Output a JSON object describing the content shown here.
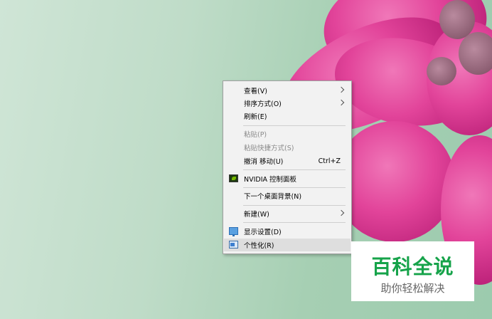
{
  "desktop": {
    "wallpaper": "pink succulent flower on green background",
    "colors": {
      "background": "#bfdcc8",
      "petal": "#e2449a"
    }
  },
  "context_menu": {
    "items": [
      {
        "label": "查看(V)",
        "has_submenu": true,
        "disabled": false
      },
      {
        "label": "排序方式(O)",
        "has_submenu": true,
        "disabled": false
      },
      {
        "label": "刷新(E)",
        "has_submenu": false,
        "disabled": false
      },
      {
        "label": "粘贴(P)",
        "has_submenu": false,
        "disabled": true
      },
      {
        "label": "粘贴快捷方式(S)",
        "has_submenu": false,
        "disabled": true
      },
      {
        "label": "撤消 移动(U)",
        "shortcut": "Ctrl+Z",
        "has_submenu": false,
        "disabled": false
      },
      {
        "label": "NVIDIA 控制面板",
        "icon": "nvidia-icon",
        "has_submenu": false,
        "disabled": false
      },
      {
        "label": "下一个桌面背景(N)",
        "has_submenu": false,
        "disabled": false
      },
      {
        "label": "新建(W)",
        "has_submenu": true,
        "disabled": false
      },
      {
        "label": "显示设置(D)",
        "icon": "display-settings-icon",
        "has_submenu": false,
        "disabled": false
      },
      {
        "label": "个性化(R)",
        "icon": "personalize-icon",
        "has_submenu": false,
        "disabled": false,
        "highlighted": true
      }
    ]
  },
  "watermark": {
    "title": "百科全说",
    "subtitle": "助你轻松解决",
    "color": "#16a34a"
  }
}
